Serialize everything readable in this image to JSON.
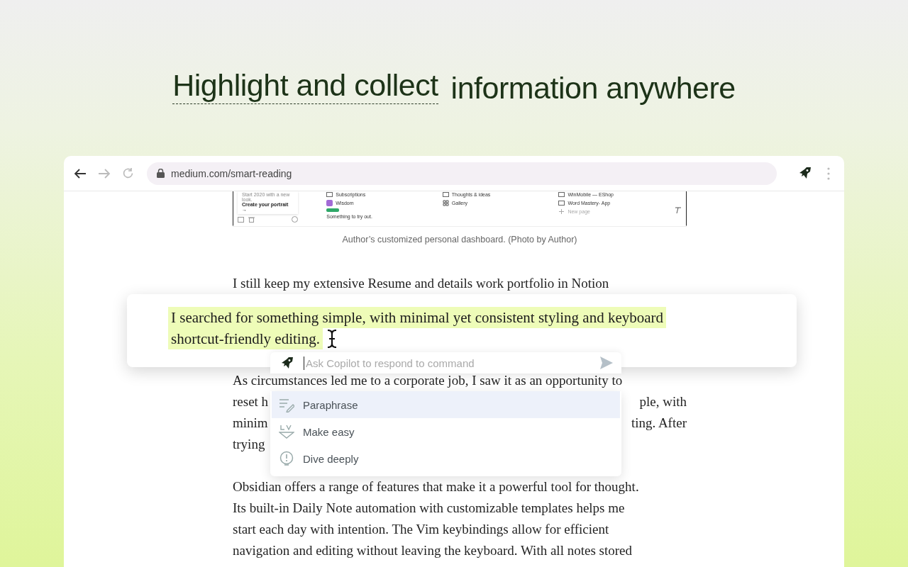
{
  "headline": {
    "highlighted": "Highlight and collect",
    "rest": "information anywhere"
  },
  "browser": {
    "url": "medium.com/smart-reading"
  },
  "figure": {
    "panel_note": "Start 2020 with a new look.",
    "panel_link": "Create your portrait →",
    "columns": [
      {
        "items": [
          {
            "label": "Subscriptions",
            "kind": "page"
          },
          {
            "label": "Wisdom",
            "kind": "app"
          },
          {
            "label": "Something to try out.",
            "kind": "note"
          }
        ]
      },
      {
        "items": [
          {
            "label": "Thoughts & ideas",
            "kind": "page"
          },
          {
            "label": "Gallery",
            "kind": "grid"
          }
        ]
      },
      {
        "items": [
          {
            "label": "WinMobile — EShop",
            "kind": "page"
          },
          {
            "label": "Word Mastery- App",
            "kind": "page"
          },
          {
            "label": "New page",
            "kind": "add"
          }
        ]
      }
    ],
    "caption": "Author’s customized personal dashboard. (Photo by Author)"
  },
  "article": {
    "paragraphs": [
      {
        "lines": [
          {
            "text": "I still keep my extensive Resume and details work portfolio in Notion"
          }
        ]
      },
      {
        "lines": [
          {
            "text": "As circumstances led me to a corporate job, I saw it as an opportunity to"
          },
          {
            "left": "reset h",
            "right": "ple, with"
          },
          {
            "left": "minim",
            "right": "ting. After"
          },
          {
            "left": "trying"
          }
        ]
      },
      {
        "lines": [
          {
            "text": "Obsidian offers a range of features that make it a powerful tool for thought."
          },
          {
            "text": "Its built-in Daily Note automation with customizable templates helps me"
          },
          {
            "text": "start each day with intention. The Vim keybindings allow for efficient"
          },
          {
            "text": "navigation and editing without leaving the keyboard. With all notes stored"
          }
        ]
      }
    ]
  },
  "highlight_card": {
    "lines": [
      "I searched for something simple, with minimal yet consistent styling and keyboard",
      "shortcut-friendly editing."
    ]
  },
  "copilot": {
    "placeholder": "Ask Copilot to respond to command",
    "actions": [
      {
        "label": "Paraphrase",
        "kind": "paraphrase",
        "selected": true
      },
      {
        "label": "Make easy",
        "kind": "easy",
        "selected": false
      },
      {
        "label": "Dive deeply",
        "kind": "deep",
        "selected": false
      }
    ]
  }
}
